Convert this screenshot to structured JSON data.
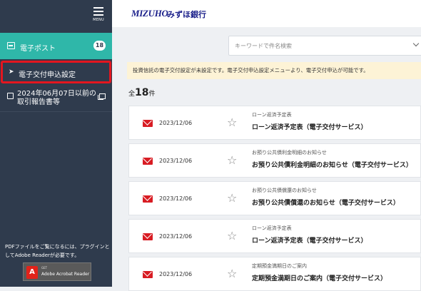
{
  "sidebar": {
    "menu_label": "MENU",
    "items": [
      {
        "label": "電子ポスト",
        "badge": "18"
      },
      {
        "label": "電子交付申込設定"
      },
      {
        "label_line1": "2024年06月07日以前の",
        "label_line2": "取引報告書等"
      }
    ],
    "pdf_note": "PDFファイルをご覧になるには、プラグインとしてAdobe Readerが必要です。",
    "acrobat": {
      "get": "GET",
      "name": "Adobe Acrobat Reader"
    }
  },
  "header": {
    "logo_text": "MIZUHO",
    "bank_name": "みずほ銀行"
  },
  "search": {
    "placeholder": "キーワードで件名検索"
  },
  "notice": "投資信託の電子交付設定が未設定です。電子交付申込設定メニューより、電子交付申込が可能です。",
  "count": {
    "prefix": "全",
    "number": "18",
    "suffix": "件"
  },
  "messages": [
    {
      "date": "2023/12/06",
      "subtitle": "ローン返済予定表",
      "title": "ローン返済予定表（電子交付サービス）"
    },
    {
      "date": "2023/12/06",
      "subtitle": "お預り公共債利金明細のお知らせ",
      "title": "お預り公共債利金明細のお知らせ（電子交付サービス）"
    },
    {
      "date": "2023/12/06",
      "subtitle": "お預り公共債償還のお知らせ",
      "title": "お預り公共債償還のお知らせ（電子交付サービス）"
    },
    {
      "date": "2023/12/06",
      "subtitle": "ローン返済予定表",
      "title": "ローン返済予定表（電子交付サービス）"
    },
    {
      "date": "2023/12/06",
      "subtitle": "定期預金満期日のご案内",
      "title": "定期預金満期日のご案内（電子交付サービス）"
    }
  ],
  "colors": {
    "sidebar": "#2f3b4d",
    "active": "#2fb7a9",
    "highlight": "#e3161f",
    "mail": "#d81c23",
    "brand": "#1a1f8a"
  }
}
